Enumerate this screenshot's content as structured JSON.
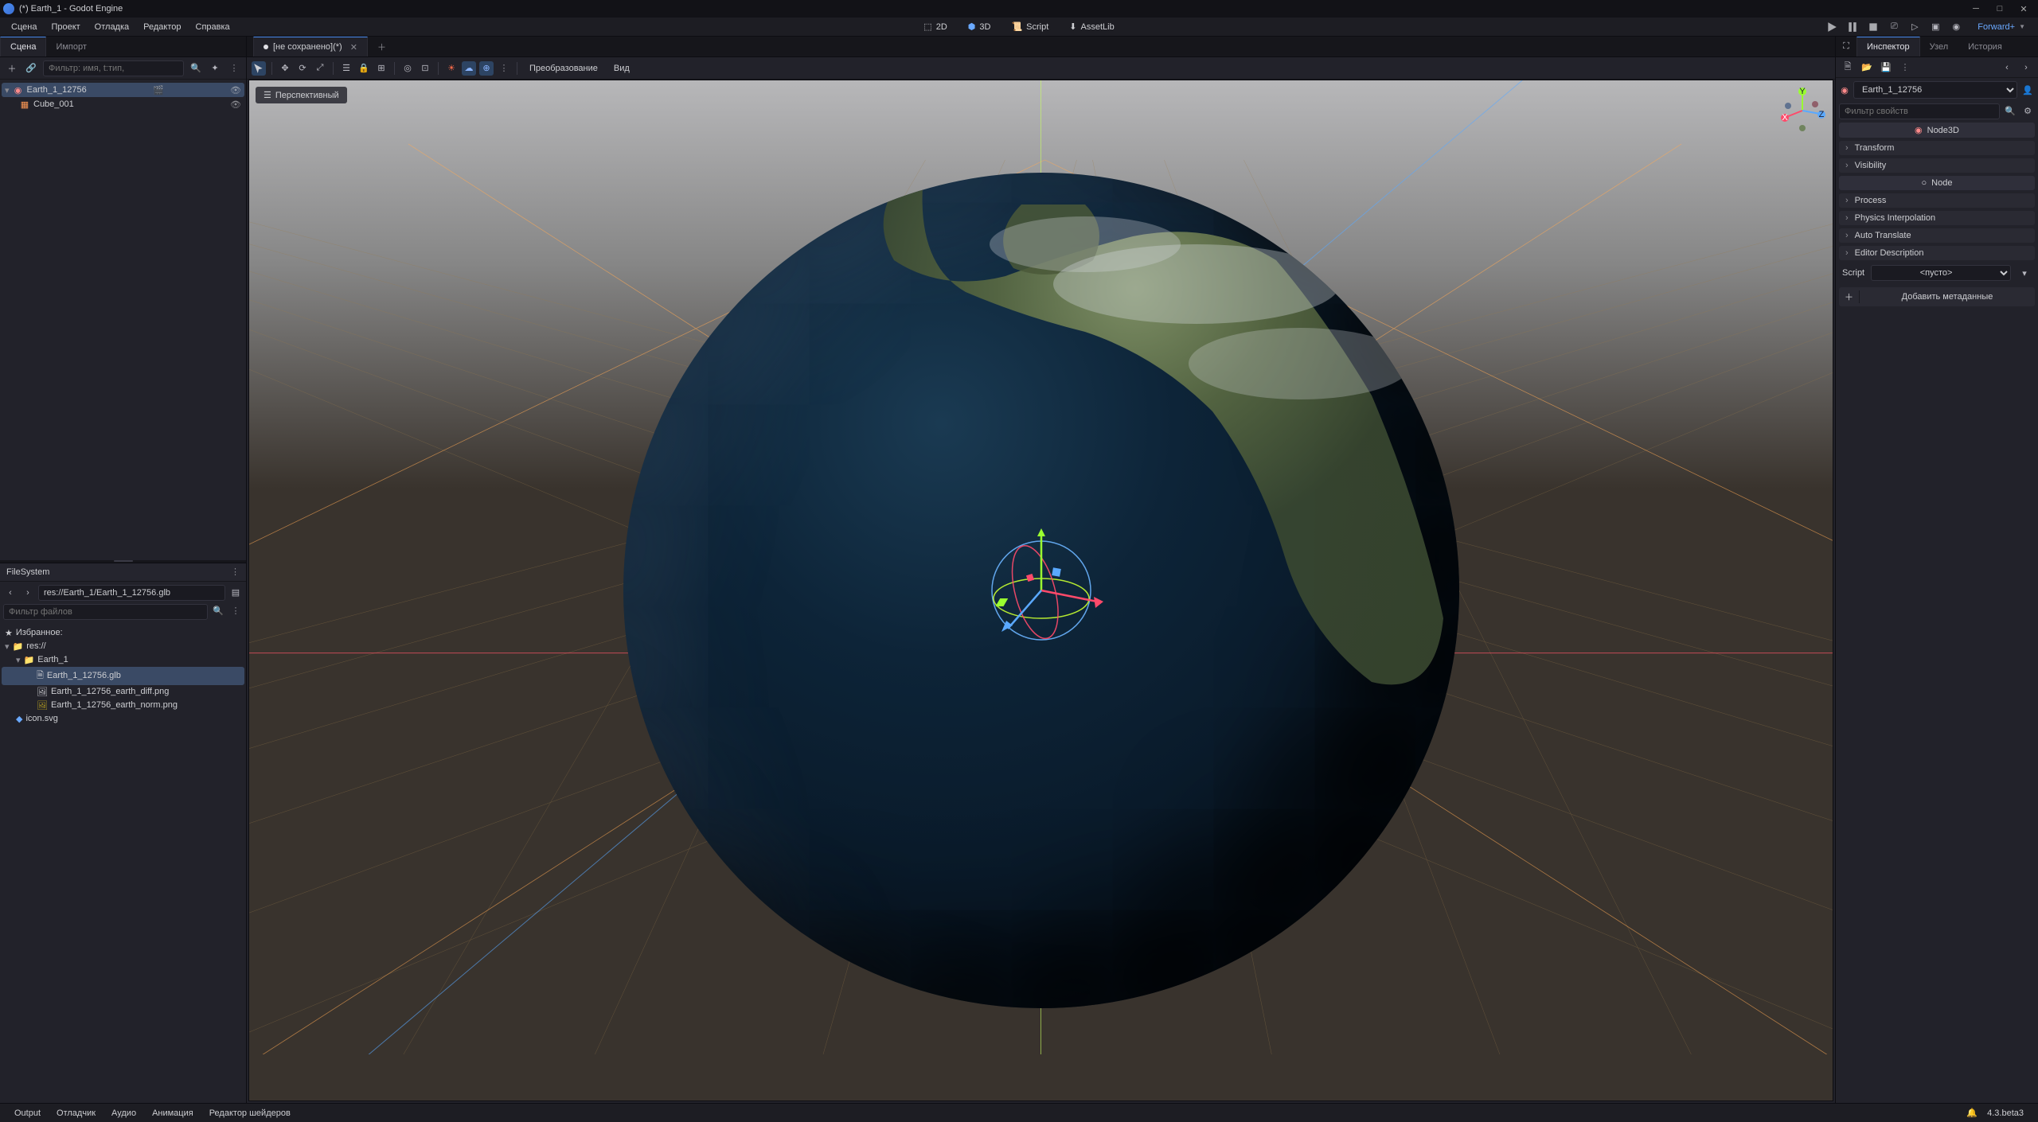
{
  "title": "(*) Earth_1 - Godot Engine",
  "menubar": {
    "scene": "Сцена",
    "project": "Проект",
    "debug": "Отладка",
    "editor": "Редактор",
    "help": "Справка"
  },
  "modes": {
    "2d": "2D",
    "3d": "3D",
    "script": "Script",
    "assetlib": "AssetLib"
  },
  "renderer": "Forward+",
  "left_tabs": {
    "scene": "Сцена",
    "import": "Импорт"
  },
  "scene_tabs": {
    "unsaved": "[не сохранено](*)"
  },
  "right_tabs": {
    "inspector": "Инспектор",
    "node": "Узел",
    "history": "История"
  },
  "scene_tree": {
    "search_placeholder": "Фильтр: имя, t:тип,",
    "root": "Earth_1_12756",
    "child": "Cube_001"
  },
  "fs": {
    "title": "FileSystem",
    "path": "res://Earth_1/Earth_1_12756.glb",
    "filter_placeholder": "Фильтр файлов",
    "fav": "Избранное:",
    "root": "res://",
    "folder": "Earth_1",
    "files": [
      "Earth_1_12756.glb",
      "Earth_1_12756_earth_diff.png",
      "Earth_1_12756_earth_norm.png"
    ],
    "icon": "icon.svg"
  },
  "center_toolbar": {
    "transform": "Преобразование",
    "view": "Вид"
  },
  "viewport": {
    "perspective": "Перспективный"
  },
  "inspector": {
    "node_name": "Earth_1_12756",
    "prop_filter": "Фильтр свойств",
    "class_node3d": "Node3D",
    "transform": "Transform",
    "visibility": "Visibility",
    "class_node": "Node",
    "process": "Process",
    "physics": "Physics Interpolation",
    "auto_translate": "Auto Translate",
    "editor_desc": "Editor Description",
    "script": "Script",
    "script_value": "<пусто>",
    "add_meta": "Добавить метаданные"
  },
  "bottom": {
    "output": "Output",
    "debugger": "Отладчик",
    "audio": "Аудио",
    "animation": "Анимация",
    "shader": "Редактор шейдеров",
    "version": "4.3.beta3"
  }
}
